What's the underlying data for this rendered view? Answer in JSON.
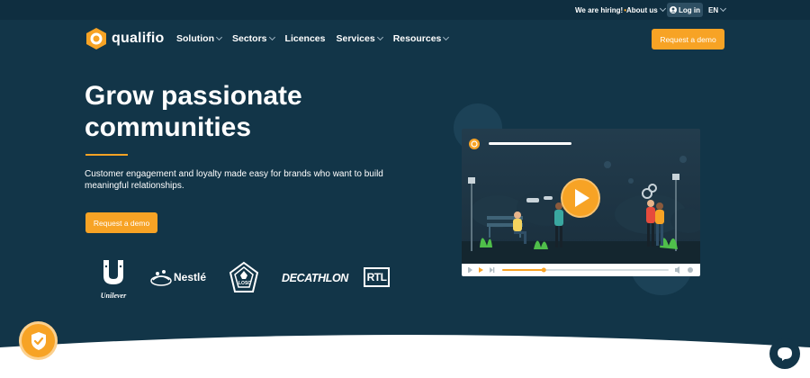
{
  "topbar": {
    "hiring": "We are hiring!",
    "hiring_mark": "•",
    "about": "About us",
    "login": "Log in",
    "lang": "EN"
  },
  "brand": {
    "name": "qualifio"
  },
  "nav": [
    "Solution",
    "Sectors",
    "Licences",
    "Services",
    "Resources"
  ],
  "header_cta": "Request a demo",
  "hero": {
    "title_line1": "Grow passionate",
    "title_line2": "communities",
    "subtitle": "Customer engagement and loyalty made easy for brands who want to build meaningful relationships.",
    "cta": "Request a demo"
  },
  "clients": {
    "unilever": "Unilever",
    "nestle": "Nestlé",
    "losc": "LOSC",
    "decathlon": "DECATHLON",
    "rtl": "RTL"
  },
  "video": {
    "progress": 0.25
  },
  "icons": {
    "login": "user-icon",
    "play": "play-icon",
    "shield": "shield-check-icon",
    "chat": "chat-bubble-icon"
  },
  "colors": {
    "navy": "#123548",
    "topbar": "#0f2e40",
    "accent": "#f7a325"
  }
}
